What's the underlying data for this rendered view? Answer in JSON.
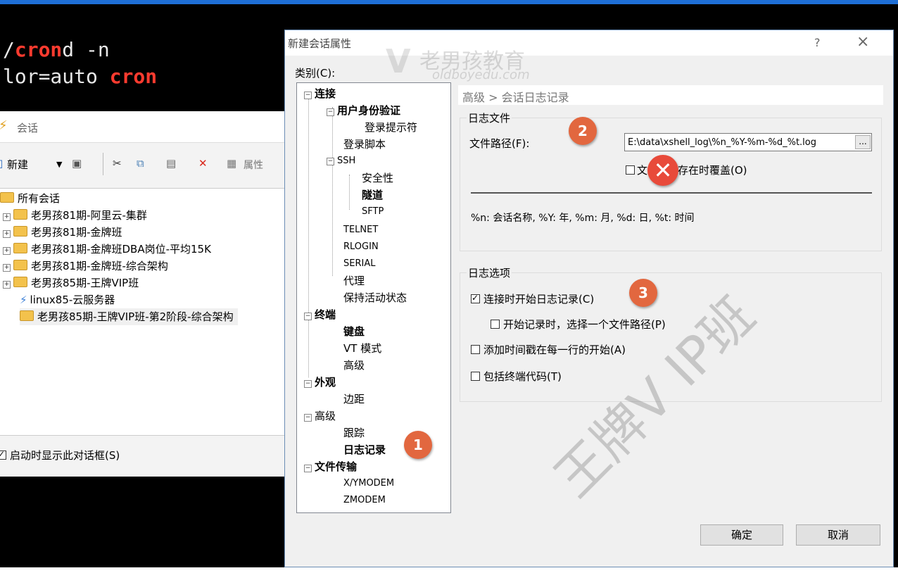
{
  "terminal": {
    "line1_prefix": "/",
    "line1_red": "cron",
    "line1_rest": "d -n",
    "line2_prefix": "lor=auto ",
    "line2_red": "cron"
  },
  "sessions_window": {
    "title": "会话",
    "toolbar": {
      "new_label": "新建",
      "properties_label": "属性"
    },
    "tree": [
      {
        "label": "所有会话",
        "type": "folder-root"
      },
      {
        "label": "老男孩81期-阿里云-集群",
        "type": "folder"
      },
      {
        "label": "老男孩81期-金牌班",
        "type": "folder"
      },
      {
        "label": "老男孩81期-金牌班DBA岗位-平均15K",
        "type": "folder"
      },
      {
        "label": "老男孩81期-金牌班-综合架构",
        "type": "folder"
      },
      {
        "label": "老男孩85期-王牌VIP班",
        "type": "folder"
      },
      {
        "label": "linux85-云服务器",
        "type": "session"
      },
      {
        "label": "老男孩85期-王牌VIP班-第2阶段-综合架构",
        "type": "folder"
      }
    ],
    "startup_checkbox_label": "启动时显示此对话框(S)"
  },
  "dialog": {
    "title": "新建会话属性",
    "help": "?",
    "close": "×",
    "category_label": "类别(C):",
    "tree": {
      "connection": "连接",
      "auth": "用户身份验证",
      "login_prompt": "登录提示符",
      "login_script": "登录脚本",
      "ssh": "SSH",
      "security": "安全性",
      "tunnel": "隧道",
      "sftp": "SFTP",
      "telnet": "TELNET",
      "rlogin": "RLOGIN",
      "serial": "SERIAL",
      "proxy": "代理",
      "keepalive": "保持活动状态",
      "terminal": "终端",
      "keyboard": "键盘",
      "vt_mode": "VT 模式",
      "advanced_term": "高级",
      "appearance": "外观",
      "margin": "边距",
      "advanced": "高级",
      "trace": "跟踪",
      "logging": "日志记录",
      "file_transfer": "文件传输",
      "xymodem": "X/YMODEM",
      "zmodem": "ZMODEM"
    },
    "breadcrumb": "高级 > 会话日志记录",
    "log_file_group": "日志文件",
    "file_path_label": "文件路径(F):",
    "file_path_value": "E:\\data\\xshell_log\\%n_%Y-%m-%d_%t.log",
    "browse_label": "...",
    "overwrite_prefix": "文",
    "overwrite_suffix": "存在时覆盖(O)",
    "format_hint": "%n: 会话名称, %Y: 年, %m: 月, %d: 日, %t: 时间",
    "log_options_group": "日志选项",
    "opt_start_on_connect": "连接时开始日志记录(C)",
    "opt_choose_path": "开始记录时，选择一个文件路径(P)",
    "opt_timestamp": "添加时间戳在每一行的开始(A)",
    "opt_terminal_codes": "包括终端代码(T)",
    "ok_label": "确定",
    "cancel_label": "取消"
  },
  "badges": {
    "one": "1",
    "two": "2",
    "three": "3"
  },
  "watermark": {
    "logo_text": "老男孩教育",
    "logo_url_text": "oldboyedu.com",
    "logo_v": "V",
    "diagonal_text": "王牌V IP班"
  },
  "colors": {
    "accent_blue": "#1e6fd6",
    "badge_orange": "#e2673f",
    "x_red": "#e84a3a",
    "terminal_red": "#ff3b2f"
  }
}
